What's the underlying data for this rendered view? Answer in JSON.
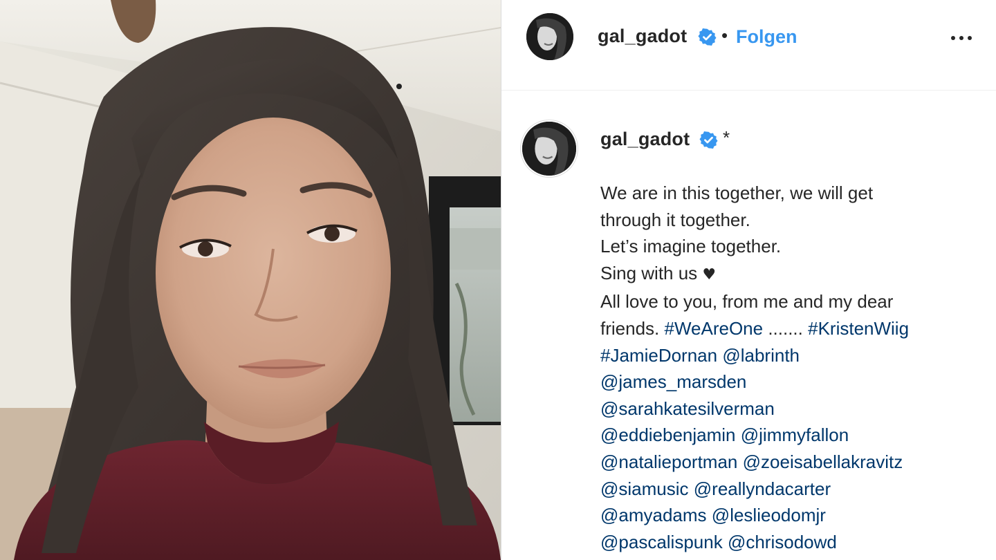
{
  "post": {
    "username": "gal_gadot",
    "verified_icon": "verified-badge-icon",
    "separator": "•",
    "follow_label": "Folgen",
    "more_icon": "more-options-icon",
    "colors": {
      "link": "#3897f0",
      "hashtag": "#00376b",
      "text": "#262626",
      "verified": "#3897f0"
    }
  },
  "caption": {
    "username": "gal_gadot",
    "marker": "*",
    "line1": "We are in this together, we will get",
    "line2": "through it together.",
    "line3": "Let’s imagine together.",
    "line4_text": "Sing with us ",
    "line4_heart": "♥",
    "line5": "All love to you, from me and my dear",
    "line6_text": "friends. ",
    "line6_tag1": "#WeAreOne",
    "line6_dots": " ....... ",
    "line6_tag2": "#KristenWiig",
    "line7_tag1": "#JamieDornan",
    "line7_tag2": "@labrinth",
    "line8_tag1": "@james_marsden",
    "line9_tag1": "@sarahkatesilverman",
    "line10_tag1": "@eddiebenjamin",
    "line10_tag2": "@jimmyfallon",
    "line11_tag1": "@natalieportman",
    "line11_tag2": "@zoeisabellakravitz",
    "line12_tag1": "@siamusic",
    "line12_tag2": "@reallyndacarter",
    "line13_tag1": "@amyadams",
    "line13_tag2": "@leslieodomjr",
    "line14_tag1": "@pascalispunk",
    "line14_tag2": "@chrisodowd"
  }
}
